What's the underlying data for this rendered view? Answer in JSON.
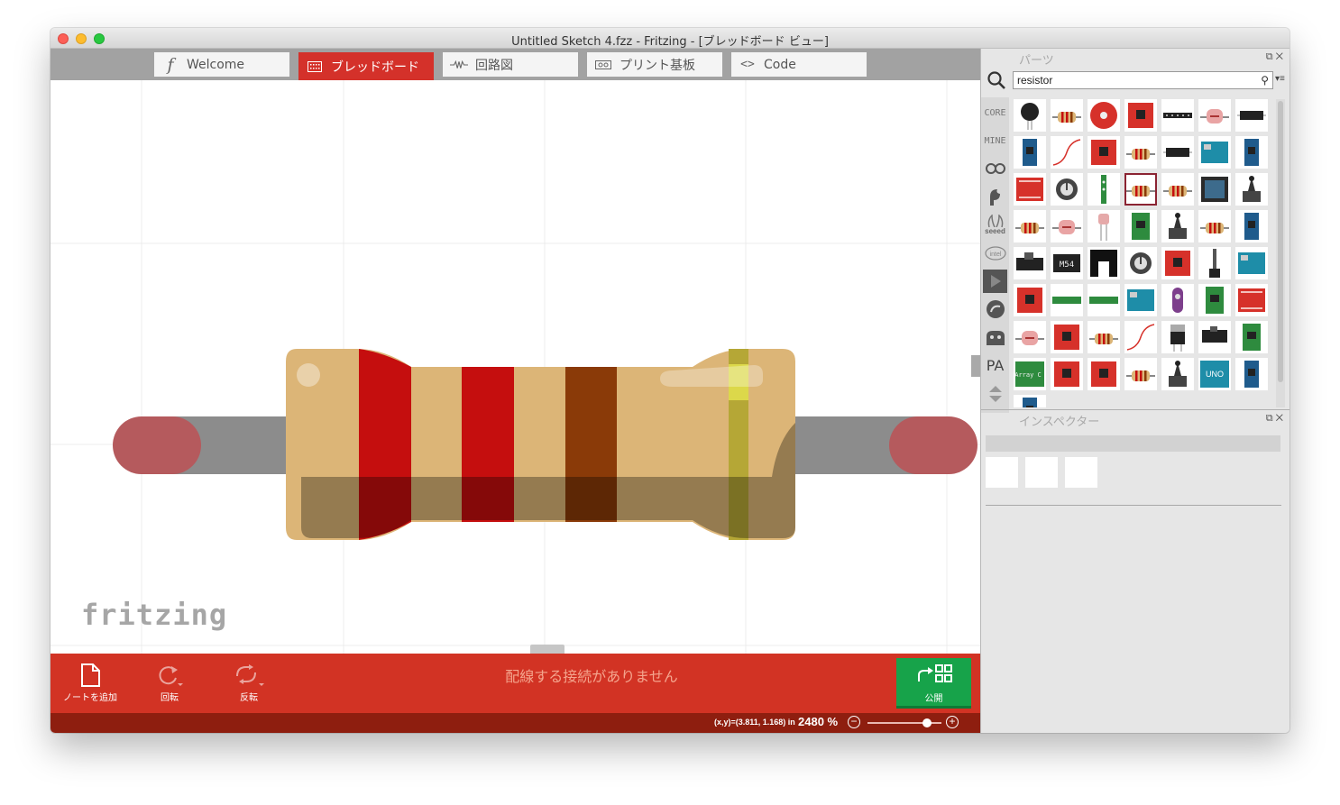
{
  "window": {
    "title": "Untitled Sketch 4.fzz - Fritzing - [ブレッドボード ビュー]"
  },
  "tabs": [
    {
      "label": "Welcome",
      "icon": "fritzing-f-icon",
      "active": false
    },
    {
      "label": "ブレッドボード",
      "icon": "breadboard-icon",
      "active": true
    },
    {
      "label": "回路図",
      "icon": "schematic-icon",
      "active": false
    },
    {
      "label": "プリント基板",
      "icon": "pcb-icon",
      "active": false
    },
    {
      "label": "Code",
      "icon": "code-icon",
      "active": false
    }
  ],
  "canvas": {
    "logo": "fritzing",
    "part": "resistor",
    "colors": {
      "body": "#dcb577",
      "leg": "#8c8c8c",
      "leg_end": "#b55a5d",
      "band1": "#c50e0e",
      "band2": "#c50e0e",
      "band3": "#8a3a08",
      "tolerance": "#b5a736"
    }
  },
  "toolbar": {
    "add_note": "ノートを追加",
    "rotate": "回転",
    "flip": "反転",
    "routing_status": "配線する接続がありません",
    "publish": "公開"
  },
  "status": {
    "coords": "(x,y)=(3.811, 1.168) in",
    "zoom": "2480 %",
    "zoom_level": 0.8
  },
  "parts_panel": {
    "title": "パーツ",
    "search_value": "resistor",
    "bins": [
      "CORE",
      "MINE",
      "arduino-icon",
      "sparkfun-icon",
      "seeed",
      "intel-icon",
      "play-icon",
      "snootlab-icon",
      "lilypad-icon",
      "PA",
      "scroll-arrows-icon"
    ],
    "rows": [
      [
        "sensor-round",
        "resistor",
        "round-board",
        "red-board",
        "header-strip",
        "ldr",
        "black-chip"
      ],
      [
        "blue-board",
        "wire",
        "red-board",
        "resistor",
        "black-chip",
        "arduino",
        "blue-board"
      ],
      [
        "red-shield",
        "potentiometer",
        "led-strip",
        "resistor",
        "resistor",
        "black-board",
        "joystick"
      ],
      [
        "resistor",
        "ldr",
        "sensor-legs",
        "green-board",
        "joystick",
        "resistor",
        "blue-board"
      ],
      [
        "black-module",
        "m54-chip",
        "black-bracket",
        "potentiometer",
        "red-board",
        "slider-pot",
        "arduino"
      ],
      [
        "red-board",
        "green-strip",
        "green-strip",
        "arduino",
        "purple-sensor",
        "green-board",
        "red-shield"
      ],
      [
        "ldr",
        "red-board",
        "resistor",
        "wire",
        "regulator",
        "black-switch",
        "green-board"
      ],
      [
        "green-array",
        "red-board",
        "red-board",
        "resistor",
        "joystick",
        "uno",
        "blue-board"
      ]
    ],
    "selected": [
      2,
      3
    ]
  },
  "inspector_panel": {
    "title": "インスペクター"
  }
}
